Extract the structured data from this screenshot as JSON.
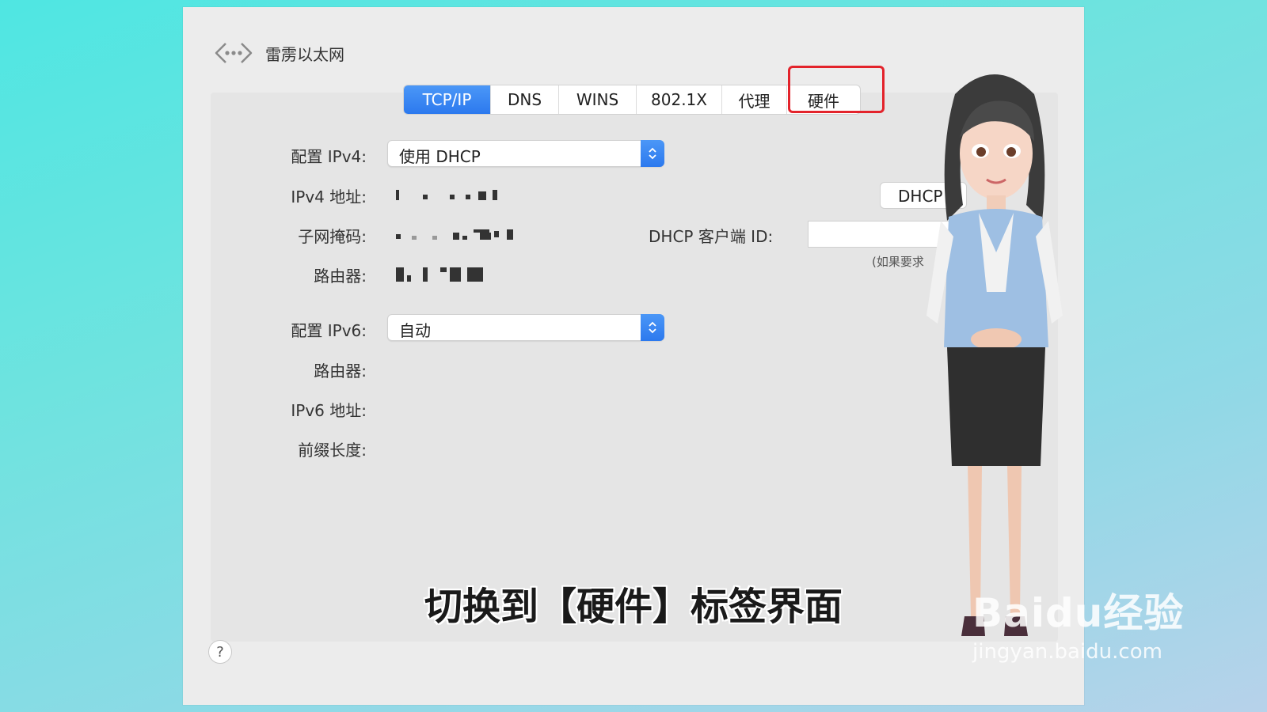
{
  "window": {
    "title": "雷雳以太网"
  },
  "tabs": [
    {
      "label": "TCP/IP",
      "active": true
    },
    {
      "label": "DNS",
      "active": false
    },
    {
      "label": "WINS",
      "active": false
    },
    {
      "label": "802.1X",
      "active": false
    },
    {
      "label": "代理",
      "active": false
    },
    {
      "label": "硬件",
      "active": false,
      "highlighted": true
    }
  ],
  "ipv4": {
    "config_label": "配置 IPv4:",
    "config_value": "使用 DHCP",
    "address_label": "IPv4 地址:",
    "subnet_label": "子网掩码:",
    "router_label": "路由器:"
  },
  "dhcp": {
    "renew_button": "DHCP",
    "client_id_label": "DHCP 客户端 ID:",
    "client_id_hint": "(如果要求"
  },
  "ipv6": {
    "config_label": "配置 IPv6:",
    "config_value": "自动",
    "router_label": "路由器:",
    "address_label": "IPv6 地址:",
    "prefix_label": "前缀长度:"
  },
  "help": "?",
  "caption": "切换到【硬件】标签界面",
  "watermark": {
    "brand": "Baidu经验",
    "url": "jingyan.baidu.com"
  },
  "colors": {
    "accent": "#2f7df0",
    "highlight_border": "#e3232b"
  }
}
